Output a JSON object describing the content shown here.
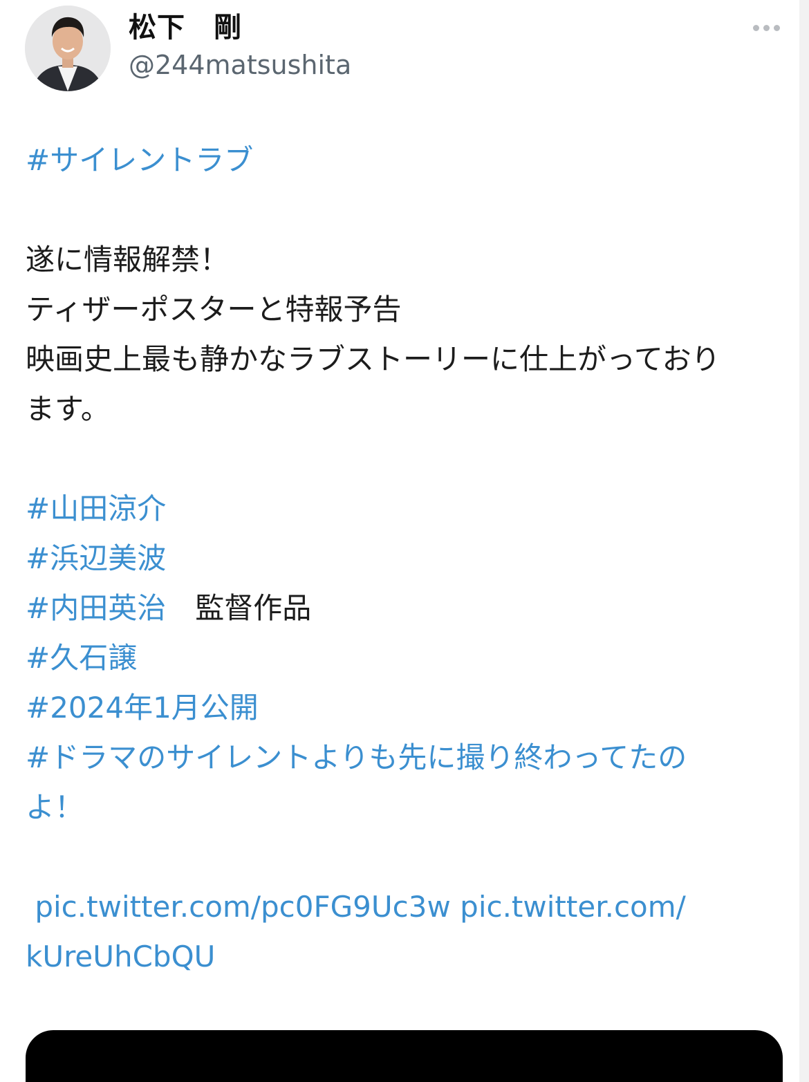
{
  "user": {
    "display_name": "松下　剛",
    "handle": "@244matsushita"
  },
  "tweet": {
    "hashtag_title": "#サイレントラブ",
    "line_1": "遂に情報解禁！",
    "line_2": "ティザーポスターと特報予告",
    "line_3": "映画史上最も静かなラブストーリーに仕上がっており",
    "line_4": "ます。",
    "tags": [
      "#山田涼介",
      "#浜辺美波",
      "#内田英治",
      "#久石譲",
      "#2024年1月公開",
      "#ドラマのサイレントよりも先に撮り終わってたの"
    ],
    "director_suffix": "　監督作品",
    "tag_continuation": "よ！",
    "link_line_1": " pic.twitter.com/pc0FG9Uc3w pic.twitter.com/",
    "link_line_2": "kUreUhCbQU"
  },
  "icons": {
    "more": "more-horizontal-icon",
    "avatar": "profile-photo"
  },
  "colors": {
    "link": "#3b8fd0",
    "text": "#1c1c1c",
    "handle": "#5b6670",
    "media_bg": "#000000"
  }
}
